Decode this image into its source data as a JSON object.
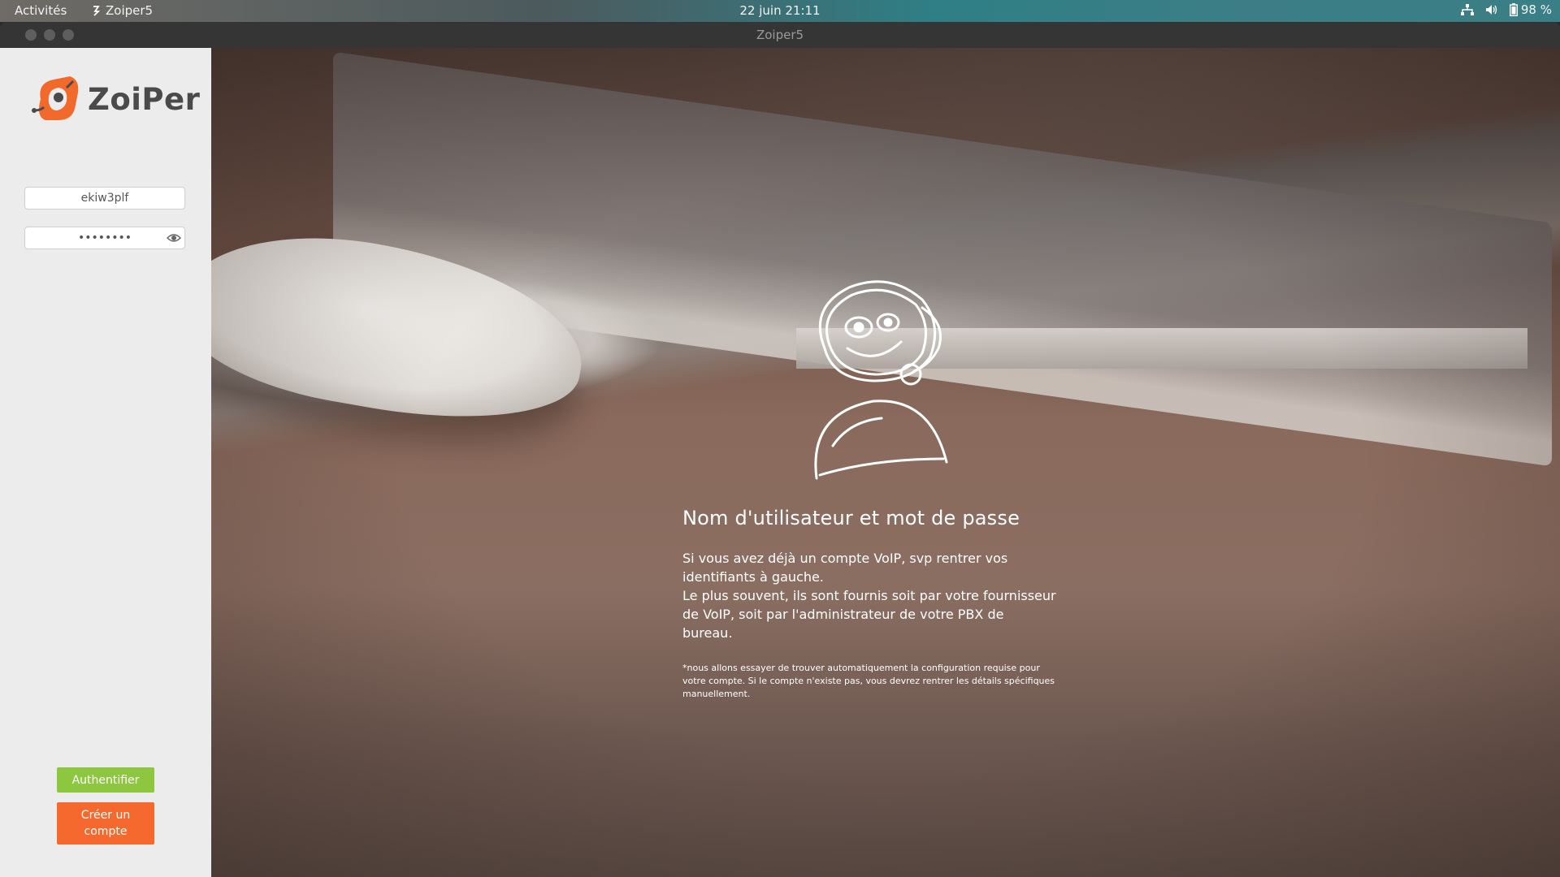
{
  "topbar": {
    "activities": "Activités",
    "app_name": "Zoiper5",
    "datetime": "22 juin  21:11",
    "battery": "98 %"
  },
  "window": {
    "title": "Zoiper5"
  },
  "sidebar": {
    "logo_text": "ZoiPer",
    "username_value": "ekiw3plf",
    "password_value": "••••••••",
    "auth_button": "Authentifier",
    "create_button": "Créer un compte"
  },
  "main": {
    "heading": "Nom d'utilisateur et mot de passe",
    "paragraph1": " Si vous avez déjà un compte VoIP, svp rentrer vos identifiants à gauche.",
    "paragraph2": "Le plus souvent, ils sont fournis soit par votre fournisseur de VoIP, soit par l'administrateur de votre PBX de bureau.",
    "note": "*nous allons essayer de trouver automatiquement la configuration requise pour votre compte. Si le compte n'existe pas, vous devrez rentrer les détails spécifiques manuellement."
  },
  "colors": {
    "accent_green": "#8dc63f",
    "accent_orange": "#f5692f",
    "sidebar_bg": "#ececec"
  },
  "icons": [
    "zoiper-logo-icon",
    "network-icon",
    "volume-icon",
    "battery-icon",
    "eye-icon",
    "mascot-illustration"
  ]
}
